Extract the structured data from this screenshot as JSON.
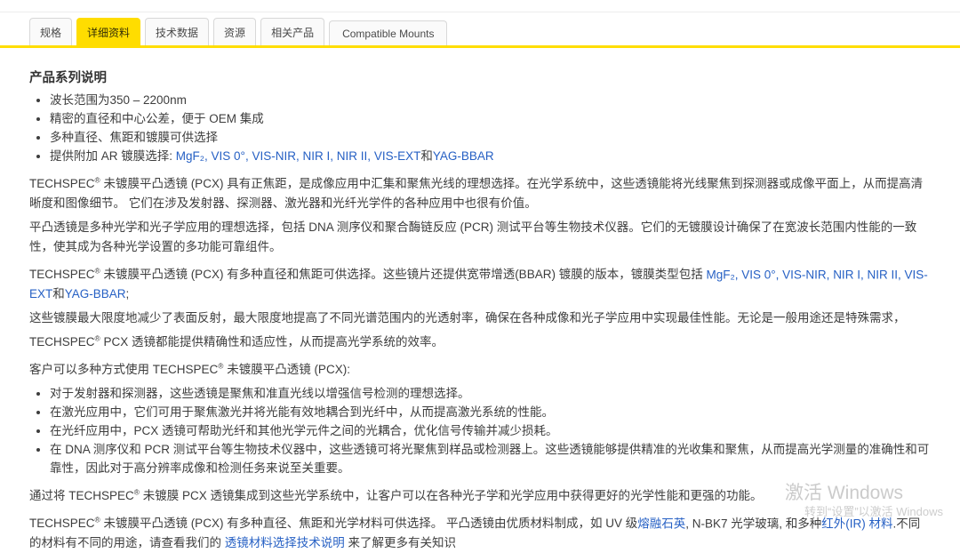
{
  "colors": {
    "accent_yellow": "#FFDD00",
    "link_blue": "#2660C4"
  },
  "tabs": [
    {
      "label": "规格",
      "active": false
    },
    {
      "label": "详细资料",
      "active": true
    },
    {
      "label": "技术数据",
      "active": false
    },
    {
      "label": "资源",
      "active": false
    },
    {
      "label": "相关产品",
      "active": false
    },
    {
      "label": "Compatible Mounts",
      "active": false
    }
  ],
  "content": {
    "heading": "产品系列说明",
    "features": [
      {
        "segments": [
          {
            "t": "波长范围为350 – 2200nm"
          }
        ]
      },
      {
        "segments": [
          {
            "t": "精密的直径和中心公差，便于 OEM 集成"
          }
        ]
      },
      {
        "segments": [
          {
            "t": "多种直径、焦距和镀膜可供选择"
          }
        ]
      },
      {
        "segments": [
          {
            "t": "提供附加 AR 镀膜选择: "
          },
          {
            "t": "MgF₂",
            "link": true
          },
          {
            "t": ", ",
            "blue": true
          },
          {
            "t": "VIS 0°",
            "link": true
          },
          {
            "t": ", ",
            "blue": true
          },
          {
            "t": "VIS-NIR",
            "link": true
          },
          {
            "t": ", ",
            "blue": true
          },
          {
            "t": "NIR I",
            "link": true
          },
          {
            "t": ", ",
            "blue": true
          },
          {
            "t": "NIR II",
            "link": true
          },
          {
            "t": ", ",
            "blue": true
          },
          {
            "t": "VIS-EXT",
            "link": true
          },
          {
            "t": "和"
          },
          {
            "t": "YAG-BBAR",
            "link": true
          }
        ]
      }
    ],
    "paragraphs_top": [
      {
        "segments": [
          {
            "t": "TECHSPEC® 未镀膜平凸透镜 (PCX) 具有正焦距，是成像应用中汇集和聚焦光线的理想选择。在光学系统中，这些透镜能将光线聚焦到探测器或成像平面上，从而提高清晰度和图像细节。 它们在涉及发射器、探测器、激光器和光纤光学件的各种应用中也很有价值。"
          }
        ]
      },
      {
        "segments": [
          {
            "t": "平凸透镜是多种光学和光子学应用的理想选择，包括 DNA 测序仪和聚合酶链反应 (PCR) 测试平台等生物技术仪器。它们的无镀膜设计确保了在宽波长范围内性能的一致性，使其成为各种光学设置的多功能可靠组件。"
          }
        ]
      },
      {
        "segments": [
          {
            "t": "TECHSPEC® 未镀膜平凸透镜 (PCX) 有多种直径和焦距可供选择。这些镜片还提供宽带增透(BBAR) 镀膜的版本，镀膜类型包括 "
          },
          {
            "t": "MgF₂",
            "link": true
          },
          {
            "t": ", ",
            "blue": true
          },
          {
            "t": "VIS 0°",
            "link": true
          },
          {
            "t": ", ",
            "blue": true
          },
          {
            "t": "VIS-NIR",
            "link": true
          },
          {
            "t": ", ",
            "blue": true
          },
          {
            "t": "NIR I",
            "link": true
          },
          {
            "t": ", ",
            "blue": true
          },
          {
            "t": "NIR II",
            "link": true
          },
          {
            "t": ", ",
            "blue": true
          },
          {
            "t": "VIS-EXT",
            "link": true
          },
          {
            "t": "和"
          },
          {
            "t": "YAG-BBAR",
            "link": true
          },
          {
            "t": ";"
          }
        ]
      },
      {
        "segments": [
          {
            "t": "这些镀膜最大限度地减少了表面反射，最大限度地提高了不同光谱范围内的光透射率，确保在各种成像和光子学应用中实现最佳性能。无论是一般用途还是特殊需求，TECHSPEC® PCX 透镜都能提供精确性和适应性，从而提高光学系统的效率。"
          }
        ]
      },
      {
        "segments": [
          {
            "t": "客户可以多种方式使用 TECHSPEC® 未镀膜平凸透镜 (PCX):"
          }
        ]
      }
    ],
    "usage_list": [
      {
        "segments": [
          {
            "t": "对于发射器和探测器，这些透镜是聚焦和准直光线以增强信号检测的理想选择。"
          }
        ]
      },
      {
        "segments": [
          {
            "t": "在激光应用中，它们可用于聚焦激光并将光能有效地耦合到光纤中，从而提高激光系统的性能。"
          }
        ]
      },
      {
        "segments": [
          {
            "t": "在光纤应用中，PCX 透镜可帮助光纤和其他光学元件之间的光耦合，优化信号传输并减少损耗。"
          }
        ]
      },
      {
        "segments": [
          {
            "t": "在 DNA 测序仪和 PCR 测试平台等生物技术仪器中，这些透镜可将光聚焦到样品或检测器上。这些透镜能够提供精准的光收集和聚焦，从而提高光学测量的准确性和可靠性，因此对于高分辨率成像和检测任务来说至关重要。"
          }
        ]
      }
    ],
    "paragraphs_bottom": [
      {
        "segments": [
          {
            "t": "通过将 TECHSPEC® 未镀膜 PCX 透镜集成到这些光学系统中，让客户可以在各种光子学和光学应用中获得更好的光学性能和更强的功能。"
          }
        ]
      },
      {
        "segments": [
          {
            "t": "TECHSPEC® 未镀膜平凸透镜 (PCX) 有多种直径、焦距和光学材料可供选择。 平凸透镜由优质材料制成，如 UV 级"
          },
          {
            "t": "熔融石英",
            "link": true
          },
          {
            "t": ", N-BK7 光学玻璃, 和多种"
          },
          {
            "t": "红外(IR) 材料",
            "link": true
          },
          {
            "t": ".不同的材料有不同的用途，请查看我们的 "
          },
          {
            "t": "透镜材料选择技术说明",
            "link": true
          },
          {
            "t": " 来了解更多有关知识"
          }
        ]
      }
    ]
  },
  "watermark": {
    "line1": "激活 Windows",
    "line2": "转到“设置”以激活 Windows"
  }
}
